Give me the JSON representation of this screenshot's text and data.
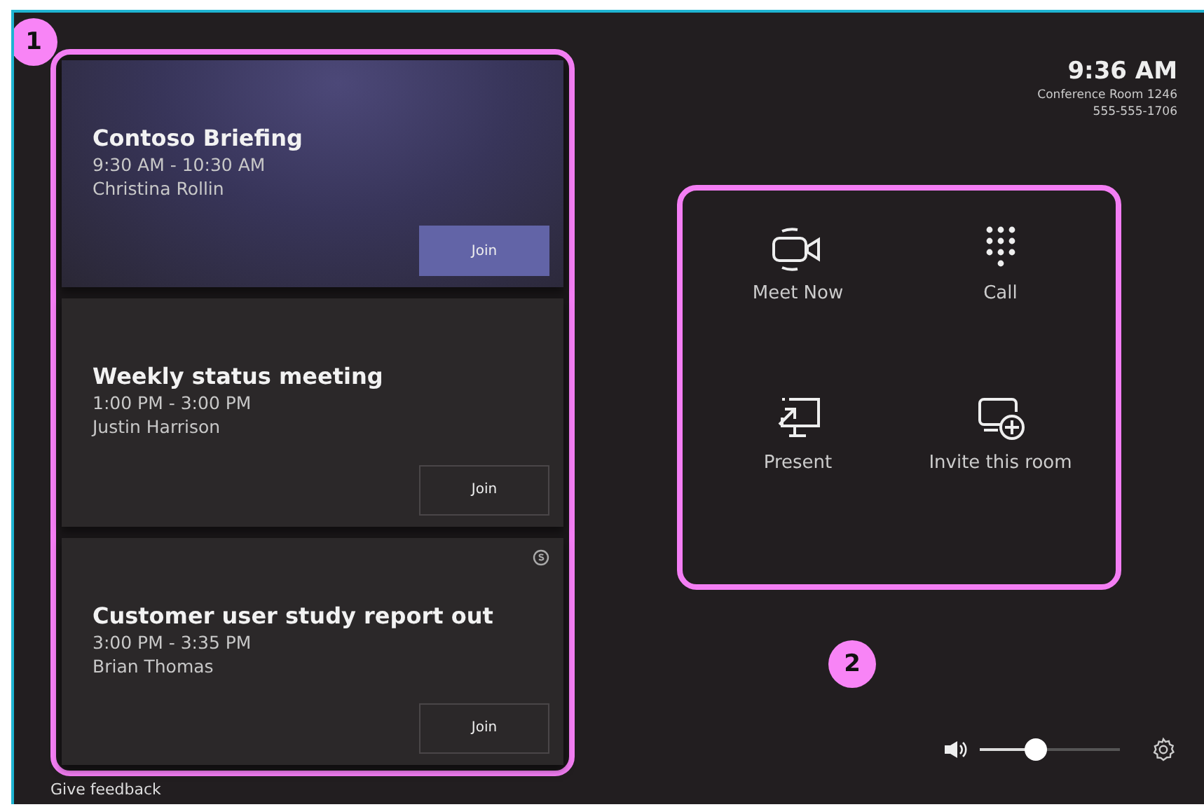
{
  "annotations": [
    {
      "label": "1"
    },
    {
      "label": "2"
    }
  ],
  "meetings": [
    {
      "title": "Contoso Briefing",
      "time": "9:30 AM - 10:30 AM",
      "organizer": "Christina Rollin",
      "highlighted": true,
      "join": "Join",
      "skype": false
    },
    {
      "title": "Weekly status meeting",
      "time": "1:00 PM - 3:00 PM",
      "organizer": "Justin Harrison",
      "highlighted": false,
      "join": "Join",
      "skype": false
    },
    {
      "title": "Customer user study report out",
      "time": "3:00 PM - 3:35 PM",
      "organizer": "Brian Thomas",
      "highlighted": false,
      "join": "Join",
      "skype": true
    }
  ],
  "feedback": "Give feedback",
  "clock": {
    "time": "9:36 AM",
    "room": "Conference Room 1246",
    "phone": "555-555-1706"
  },
  "actions": [
    {
      "kind": "meet",
      "label": "Meet Now"
    },
    {
      "kind": "call",
      "label": "Call"
    },
    {
      "kind": "present",
      "label": "Present"
    },
    {
      "kind": "invite",
      "label": "Invite this room"
    }
  ],
  "volume": {
    "level": 0.4
  }
}
